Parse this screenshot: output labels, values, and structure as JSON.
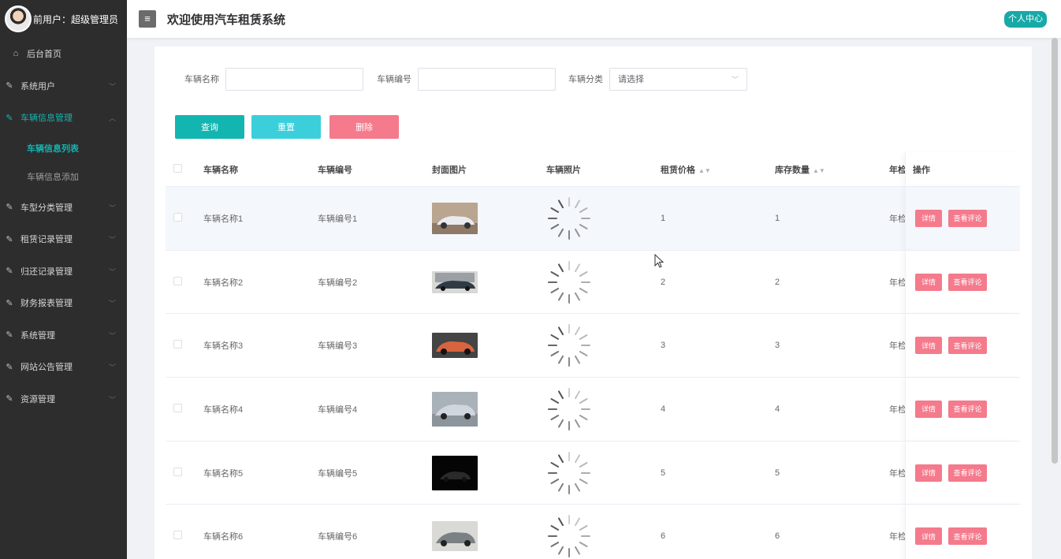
{
  "sidebar": {
    "user_label": "前用户：超级管理员",
    "home": "后台首页",
    "menu": [
      {
        "label": "系统用户"
      },
      {
        "label": "车辆信息管理",
        "active": true,
        "children": [
          "车辆信息列表",
          "车辆信息添加"
        ]
      },
      {
        "label": "车型分类管理"
      },
      {
        "label": "租赁记录管理"
      },
      {
        "label": "归还记录管理"
      },
      {
        "label": "财务报表管理"
      },
      {
        "label": "系统管理"
      },
      {
        "label": "网站公告管理"
      },
      {
        "label": "资源管理"
      }
    ]
  },
  "header": {
    "menu_icon": "≡",
    "title": "欢迎使用汽车租赁系统",
    "personal_center": "个人中心"
  },
  "search": {
    "name_label": "车辆名称",
    "name_value": "",
    "no_label": "车辆编号",
    "no_value": "",
    "category_label": "车辆分类",
    "category_placeholder": "请选择"
  },
  "buttons": {
    "query": "查询",
    "reset": "重置",
    "delete": "删除"
  },
  "table": {
    "headers": {
      "name": "车辆名称",
      "no": "车辆编号",
      "cover": "封面图片",
      "photo": "车辆照片",
      "price": "租赁价格",
      "stock": "库存数量",
      "year": "年检",
      "ops": "操作"
    },
    "rows": [
      {
        "name": "车辆名称1",
        "no": "车辆编号1",
        "price": "1",
        "stock": "1",
        "year": "年检",
        "detail": "详情",
        "comment": "查看评论"
      },
      {
        "name": "车辆名称2",
        "no": "车辆编号2",
        "price": "2",
        "stock": "2",
        "year": "年检",
        "detail": "详情",
        "comment": "查看评论"
      },
      {
        "name": "车辆名称3",
        "no": "车辆编号3",
        "price": "3",
        "stock": "3",
        "year": "年检",
        "detail": "详情",
        "comment": "查看评论"
      },
      {
        "name": "车辆名称4",
        "no": "车辆编号4",
        "price": "4",
        "stock": "4",
        "year": "年检",
        "detail": "详情",
        "comment": "查看评论"
      },
      {
        "name": "车辆名称5",
        "no": "车辆编号5",
        "price": "5",
        "stock": "5",
        "year": "年检",
        "detail": "详情",
        "comment": "查看评论"
      },
      {
        "name": "车辆名称6",
        "no": "车辆编号6",
        "price": "6",
        "stock": "6",
        "year": "年检",
        "detail": "详情",
        "comment": "查看评论"
      }
    ]
  },
  "colors": {
    "accent": "#13b5b1",
    "reset": "#3bcfdc",
    "danger": "#f47a8c",
    "sidebar_bg": "#2d2d2d"
  }
}
